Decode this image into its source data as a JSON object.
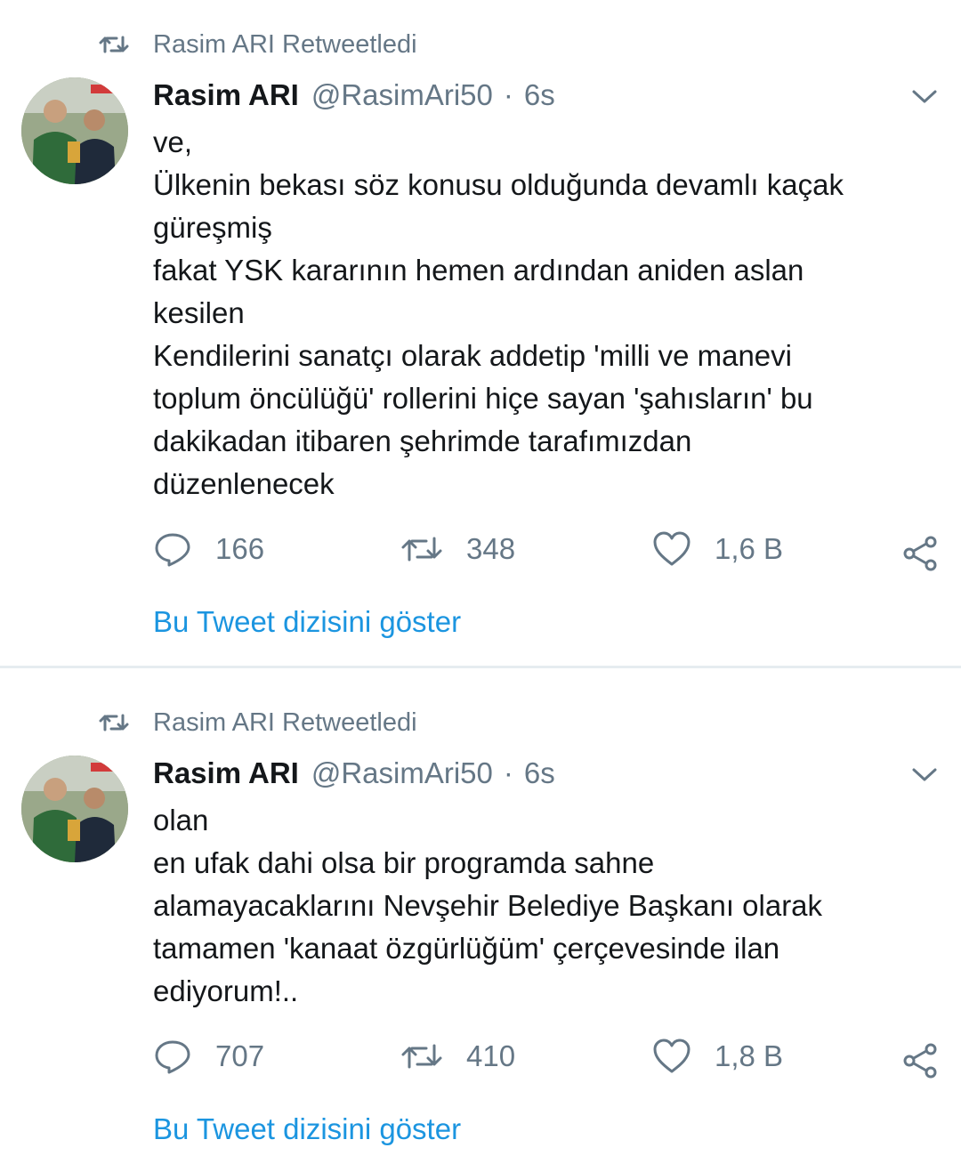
{
  "tweets": [
    {
      "retweeted_by": "Rasim ARI Retweetledi",
      "author_name": "Rasim ARI",
      "handle": "@RasimAri50",
      "separator": "·",
      "time": "6s",
      "lines": [
        "ve,",
        "Ülkenin bekası söz konusu olduğunda devamlı kaçak",
        "güreşmiş",
        "fakat YSK kararının hemen ardından aniden aslan",
        "kesilen",
        "Kendilerini sanatçı olarak addetip 'milli ve manevi",
        "toplum öncülüğü' rollerini hiçe sayan 'şahısların' bu",
        "dakikadan itibaren şehrimde tarafımızdan",
        "düzenlenecek"
      ],
      "replies": "166",
      "retweets": "348",
      "likes": "1,6 B",
      "thread_link": "Bu Tweet dizisini göster"
    },
    {
      "retweeted_by": "Rasim ARI Retweetledi",
      "author_name": "Rasim ARI",
      "handle": "@RasimAri50",
      "separator": "·",
      "time": "6s",
      "lines": [
        "olan",
        "en ufak dahi olsa bir programda sahne",
        "alamayacaklarını Nevşehir Belediye Başkanı olarak",
        "tamamen 'kanaat özgürlüğüm' çerçevesinde ilan",
        "ediyorum!.."
      ],
      "replies": "707",
      "retweets": "410",
      "likes": "1,8 B",
      "thread_link": "Bu Tweet dizisini göster"
    }
  ],
  "colors": {
    "text_primary": "#14171a",
    "text_secondary": "#657786",
    "link": "#1b95e0",
    "divider": "#e6ecf0"
  },
  "icons": {
    "retweeted_indicator": "retweet-icon",
    "menu": "chevron-down-icon",
    "reply": "reply-icon",
    "retweet": "retweet-icon",
    "like": "heart-icon",
    "share": "share-icon"
  }
}
